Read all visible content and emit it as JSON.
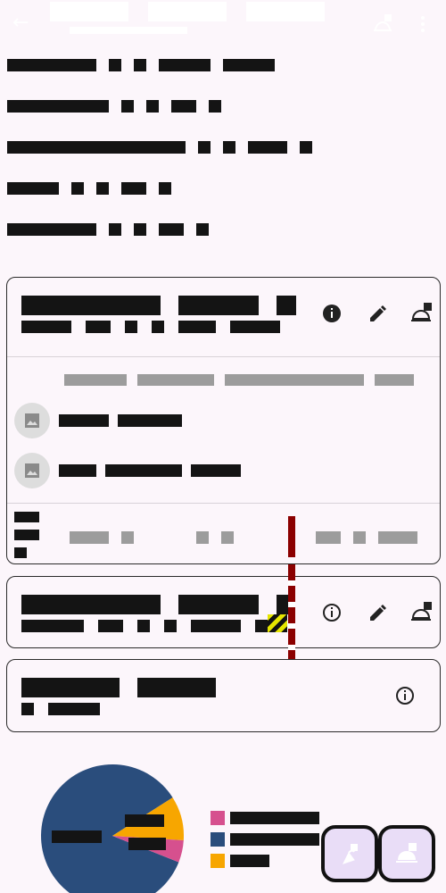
{
  "app_bar": {
    "back_icon": "arrow-back-icon",
    "actions": [
      "hide-source-icon",
      "more-vert-icon"
    ]
  },
  "summary_rows": 5,
  "cards": [
    {
      "icons": [
        "info-filled-icon",
        "edit-icon",
        "room-service-icon"
      ],
      "list_items": 2
    },
    {
      "icons": [
        "info-outline-icon",
        "edit-icon",
        "room-service-icon"
      ]
    },
    {
      "icons": [
        "info-outline-icon"
      ]
    }
  ],
  "chart_data": {
    "type": "pie",
    "slices": [
      {
        "color": "#2a4d7c",
        "value": 0.85
      },
      {
        "color": "#f7a600",
        "value": 0.1
      },
      {
        "color": "#d6508e",
        "value": 0.05
      }
    ],
    "legend_placement": "right",
    "legend_colors": [
      "#d6508e",
      "#2a4d7c",
      "#f7a600"
    ]
  },
  "fabs": [
    "add-food-icon",
    "room-service-icon"
  ],
  "colors": {
    "background": "#fcf6fb",
    "fab_fill": "#e9ddf7",
    "marker": "#8b0000"
  }
}
